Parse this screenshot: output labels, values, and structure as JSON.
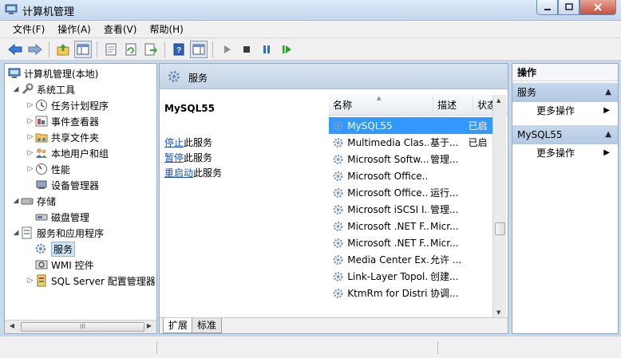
{
  "window": {
    "title": "计算机管理",
    "buttons": [
      "minimize",
      "maximize",
      "close"
    ]
  },
  "menubar": {
    "items": [
      "文件(F)",
      "操作(A)",
      "查看(V)",
      "帮助(H)"
    ]
  },
  "toolbar": {
    "icons": [
      "back-arrow-icon",
      "forward-arrow-icon",
      "up-folder-icon",
      "show-hide-tree-icon",
      "properties-icon",
      "refresh-icon",
      "export-list-icon",
      "help-icon",
      "show-hide-action-pane-icon",
      "start-service-icon",
      "stop-service-icon",
      "pause-service-icon",
      "resume-service-icon"
    ]
  },
  "tree": {
    "root": "计算机管理(本地)",
    "items": [
      {
        "label": "系统工具",
        "level": 1,
        "expander": "expanded"
      },
      {
        "label": "任务计划程序",
        "level": 2,
        "expander": "collapsed"
      },
      {
        "label": "事件查看器",
        "level": 2,
        "expander": "collapsed"
      },
      {
        "label": "共享文件夹",
        "level": 2,
        "expander": "collapsed"
      },
      {
        "label": "本地用户和组",
        "level": 2,
        "expander": "collapsed"
      },
      {
        "label": "性能",
        "level": 2,
        "expander": "collapsed"
      },
      {
        "label": "设备管理器",
        "level": 2,
        "expander": "none"
      },
      {
        "label": "存储",
        "level": 1,
        "expander": "expanded"
      },
      {
        "label": "磁盘管理",
        "level": 2,
        "expander": "none"
      },
      {
        "label": "服务和应用程序",
        "level": 1,
        "expander": "expanded"
      },
      {
        "label": "服务",
        "level": 2,
        "expander": "none",
        "selected": true
      },
      {
        "label": "WMI 控件",
        "level": 2,
        "expander": "none"
      },
      {
        "label": "SQL Server 配置管理器",
        "level": 2,
        "expander": "collapsed"
      }
    ],
    "scroll_thumb_grip": "III"
  },
  "center": {
    "header_title": "服务",
    "detail_title": "MySQL55",
    "actions": [
      {
        "link": "停止",
        "suffix": "此服务"
      },
      {
        "link": "暂停",
        "suffix": "此服务"
      },
      {
        "link": "重启动",
        "suffix": "此服务"
      }
    ],
    "columns": [
      "名称",
      "描述",
      "状态"
    ],
    "rows": [
      {
        "name": "MySQL55",
        "desc": "",
        "status": "已启",
        "selected": true
      },
      {
        "name": "Multimedia Clas...",
        "desc": "基于...",
        "status": "已启"
      },
      {
        "name": "Microsoft Softw...",
        "desc": "管理...",
        "status": ""
      },
      {
        "name": "Microsoft Office...",
        "desc": "",
        "status": ""
      },
      {
        "name": "Microsoft Office...",
        "desc": "运行...",
        "status": ""
      },
      {
        "name": "Microsoft iSCSI I...",
        "desc": "管理...",
        "status": ""
      },
      {
        "name": "Microsoft .NET F...",
        "desc": "Micr...",
        "status": ""
      },
      {
        "name": "Microsoft .NET F...",
        "desc": "Micr...",
        "status": ""
      },
      {
        "name": "Media Center Ex...",
        "desc": "允许 ...",
        "status": ""
      },
      {
        "name": "Link-Layer Topol...",
        "desc": "创建...",
        "status": ""
      },
      {
        "name": "KtmRm for Distri...",
        "desc": "协调...",
        "status": ""
      }
    ],
    "tabs": [
      "扩展",
      "标准"
    ],
    "active_tab": "扩展"
  },
  "actions_pane": {
    "title": "操作",
    "sections": [
      {
        "title": "服务",
        "items": [
          "更多操作"
        ]
      },
      {
        "title": "MySQL55",
        "items": [
          "更多操作"
        ]
      }
    ]
  },
  "colors": {
    "selection": "#3399ff",
    "link": "#1a4fc0",
    "section_header": "#c7d8ed"
  }
}
